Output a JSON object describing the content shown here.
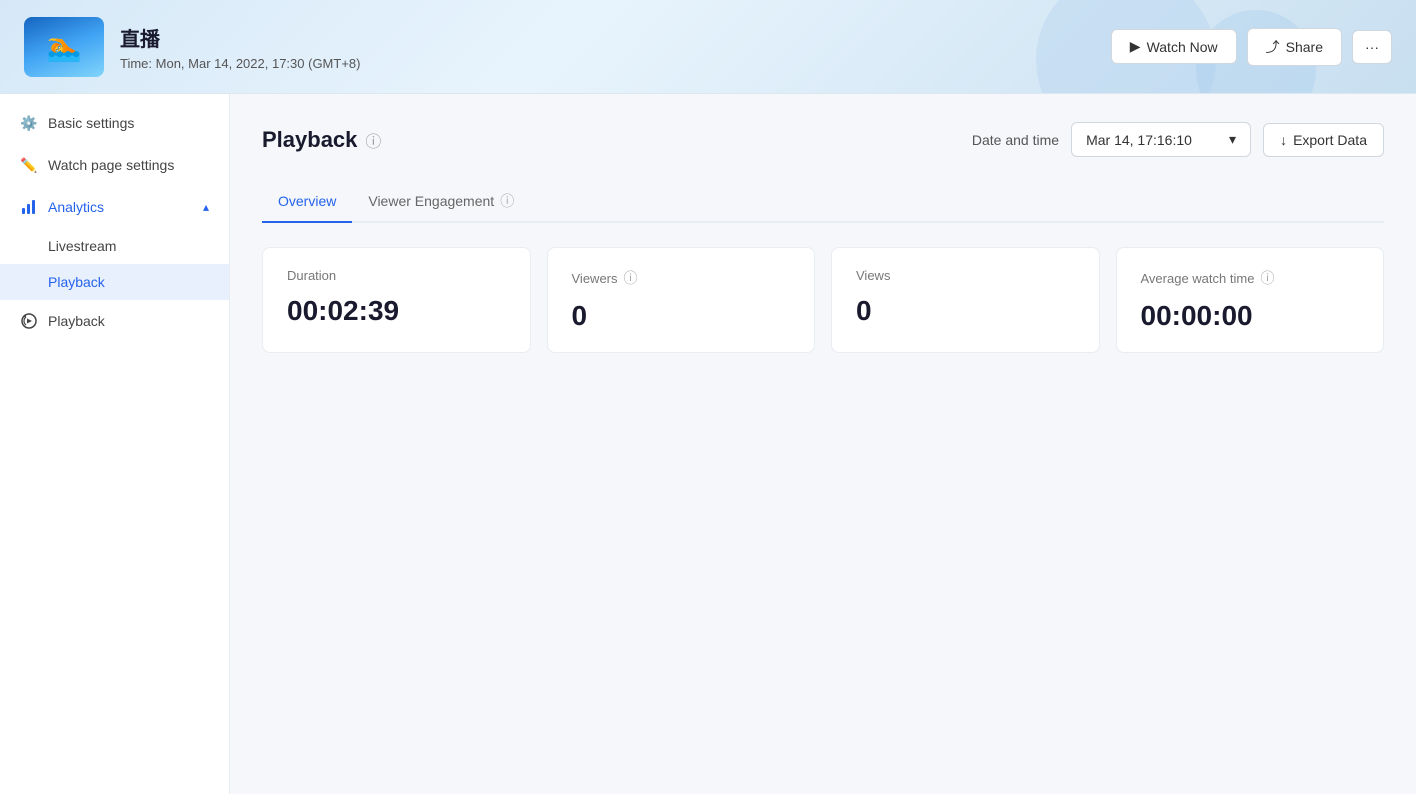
{
  "header": {
    "title": "直播",
    "subtitle": "Time: Mon, Mar 14, 2022, 17:30 (GMT+8)",
    "watch_now_label": "Watch Now",
    "share_label": "Share",
    "more_label": "···",
    "thumbnail_emoji": "🏊"
  },
  "sidebar": {
    "items": [
      {
        "id": "basic-settings",
        "label": "Basic settings",
        "icon": "⚙️"
      },
      {
        "id": "watch-page-settings",
        "label": "Watch page settings",
        "icon": "✏️"
      },
      {
        "id": "analytics",
        "label": "Analytics",
        "icon": "📊"
      }
    ],
    "sub_items": [
      {
        "id": "livestream",
        "label": "Livestream"
      },
      {
        "id": "playback",
        "label": "Playback"
      }
    ],
    "playback_item": {
      "id": "playback2",
      "label": "Playback",
      "icon": "🔄"
    }
  },
  "main": {
    "page_title": "Playback",
    "date_label": "Date and time",
    "date_value": "Mar 14, 17:16:10",
    "export_label": "Export Data",
    "tabs": [
      {
        "id": "overview",
        "label": "Overview",
        "active": true
      },
      {
        "id": "viewer-engagement",
        "label": "Viewer Engagement"
      }
    ],
    "stats": [
      {
        "id": "duration",
        "label": "Duration",
        "value": "00:02:39",
        "has_info": false
      },
      {
        "id": "viewers",
        "label": "Viewers",
        "value": "0",
        "has_info": true
      },
      {
        "id": "views",
        "label": "Views",
        "value": "0",
        "has_info": false
      },
      {
        "id": "avg-watch-time",
        "label": "Average watch time",
        "value": "00:00:00",
        "has_info": true
      }
    ]
  },
  "icons": {
    "info": "ⓘ",
    "chevron_down": "▾",
    "chevron_up": "▴",
    "download": "↓",
    "play": "▶",
    "share": "⤴"
  }
}
